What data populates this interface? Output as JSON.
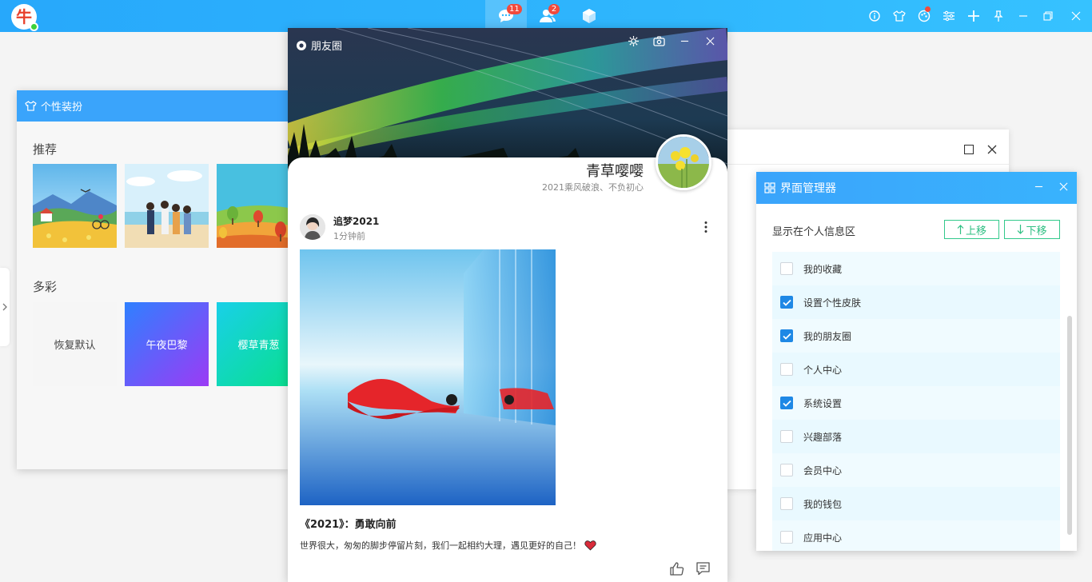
{
  "topbar": {
    "logo_char": "牛",
    "tabs": [
      {
        "icon": "chat-bubble-icon",
        "badge": "11",
        "active": true
      },
      {
        "icon": "contacts-icon",
        "badge": "2",
        "active": false
      },
      {
        "icon": "cube-icon",
        "badge": "",
        "active": false
      }
    ],
    "right_icons": [
      "info-icon",
      "tshirt-icon",
      "palette-icon",
      "sliders-icon",
      "plus-icon",
      "pin-icon",
      "minimize-icon",
      "restore-icon",
      "close-icon"
    ]
  },
  "skin_window": {
    "title": "个性装扮",
    "section_recommend": "推荐",
    "section_colorful": "多彩",
    "color_tiles": [
      {
        "label": "恢复默认",
        "colors": [
          "#f6f6f6",
          "#f6f6f6"
        ]
      },
      {
        "label": "午夜巴黎",
        "colors": [
          "#2f80ff",
          "#9b3bf5"
        ]
      },
      {
        "label": "樱草青葱",
        "colors": [
          "#19d0e8",
          "#08e08a"
        ]
      }
    ]
  },
  "moments": {
    "title": "朋友圈",
    "user_name": "青草嘤嘤",
    "signature": "2021乘风破浪、不负初心",
    "post": {
      "author": "追梦2021",
      "time": "1分钟前",
      "title": "《2021》：勇敢向前",
      "text": "世界很大，匆匆的脚步停留片刻，我们一起相约大理，遇见更好的自己！"
    }
  },
  "ui_manager": {
    "title": "界面管理器",
    "label": "显示在个人信息区",
    "up_label": "上移",
    "down_label": "下移",
    "items": [
      {
        "label": "我的收藏",
        "checked": false
      },
      {
        "label": "设置个性皮肤",
        "checked": true
      },
      {
        "label": "我的朋友圈",
        "checked": true
      },
      {
        "label": "个人中心",
        "checked": false
      },
      {
        "label": "系统设置",
        "checked": true
      },
      {
        "label": "兴趣部落",
        "checked": false
      },
      {
        "label": "会员中心",
        "checked": false
      },
      {
        "label": "我的钱包",
        "checked": false
      },
      {
        "label": "应用中心",
        "checked": false
      }
    ]
  },
  "colors": {
    "accent": "#3aa4fb",
    "green": "#2fbf83",
    "badge": "#f24a3c",
    "check": "#1e88e5"
  }
}
